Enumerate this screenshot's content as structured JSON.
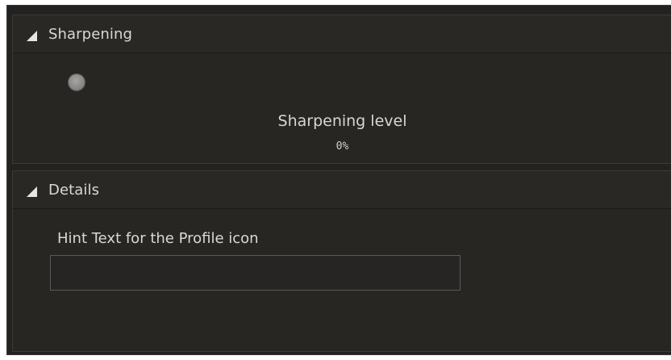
{
  "sharpening": {
    "title": "Sharpening",
    "level_label": "Sharpening level",
    "level_value": "0%",
    "level_fraction": 0
  },
  "details": {
    "title": "Details",
    "hint_label": "Hint Text for the Profile icon",
    "hint_value": "",
    "hint_placeholder": ""
  },
  "icons": {
    "collapse": "triangle-down-left-icon"
  },
  "colors": {
    "background": "#232220",
    "panel": "#272623",
    "text": "#d8d8d8"
  }
}
